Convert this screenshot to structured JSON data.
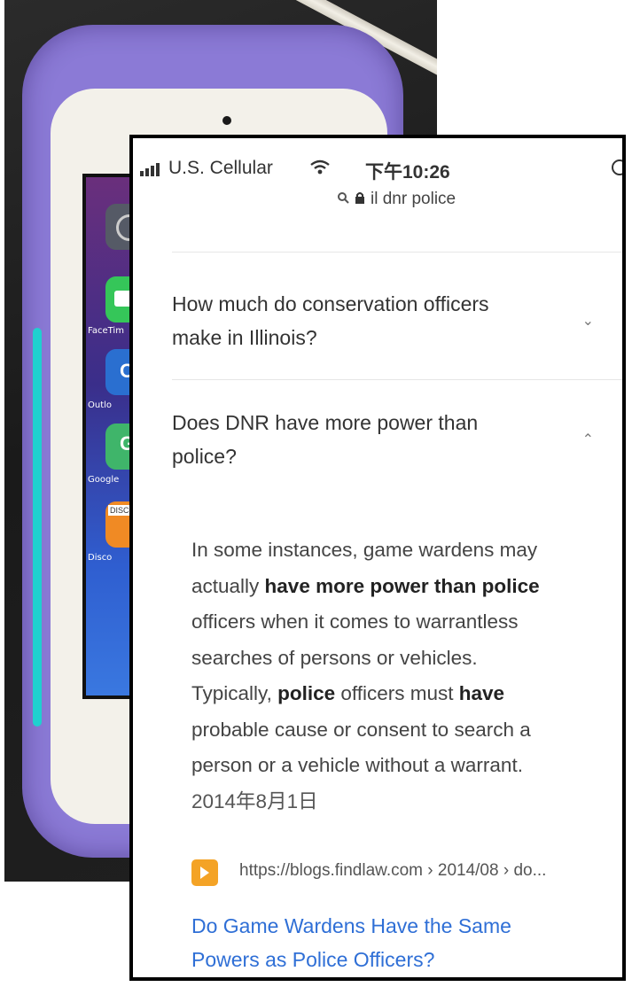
{
  "background_photo": {
    "home_icons": [
      {
        "icon": "settings-icon",
        "label": "",
        "color": "#555a66"
      },
      {
        "icon": "facetime-icon",
        "label": "FaceTim",
        "color": "#35c659"
      },
      {
        "icon": "outlook-icon",
        "label": "Outlo",
        "color": "#2a6fd0"
      },
      {
        "icon": "google-maps-icon",
        "label": "Google",
        "color": "#3fb56a"
      },
      {
        "icon": "discover-icon",
        "label": "Disco",
        "color": "#f08a24"
      }
    ],
    "discover_badge": "DISCOV",
    "outlook_letter": "O",
    "maps_letter": "G"
  },
  "status_bar": {
    "carrier": "U.S. Cellular",
    "time": "下午10:26"
  },
  "url_bar": {
    "text": "il dnr police"
  },
  "faq": [
    {
      "line1": "How much do conservation officers",
      "line2": "make in Illinois?"
    },
    {
      "line1": "Does DNR have more power than",
      "line2": "police?"
    }
  ],
  "answer": {
    "l1": "In some instances, game wardens may",
    "l2_pre": "actually ",
    "l2_bold": "have more power than police",
    "l3": "officers when it comes to warrantless",
    "l4": "searches of persons or vehicles.",
    "l5_pre": "Typically, ",
    "l5_b1": "police",
    "l5_mid": " officers must ",
    "l5_b2": "have",
    "l6": "probable cause or consent to search a",
    "l7": "person or a vehicle without a warrant.",
    "date": "2014年8月1日"
  },
  "source": {
    "url": "https://blogs.findlaw.com › 2014/08 › do..."
  },
  "result": {
    "title_line1": "Do Game Wardens Have the Same",
    "title_line2": "Powers as Police Officers?"
  },
  "colors": {
    "link": "#2f6fd6",
    "case": "#8b7ad6",
    "favicon": "#f4a326"
  }
}
